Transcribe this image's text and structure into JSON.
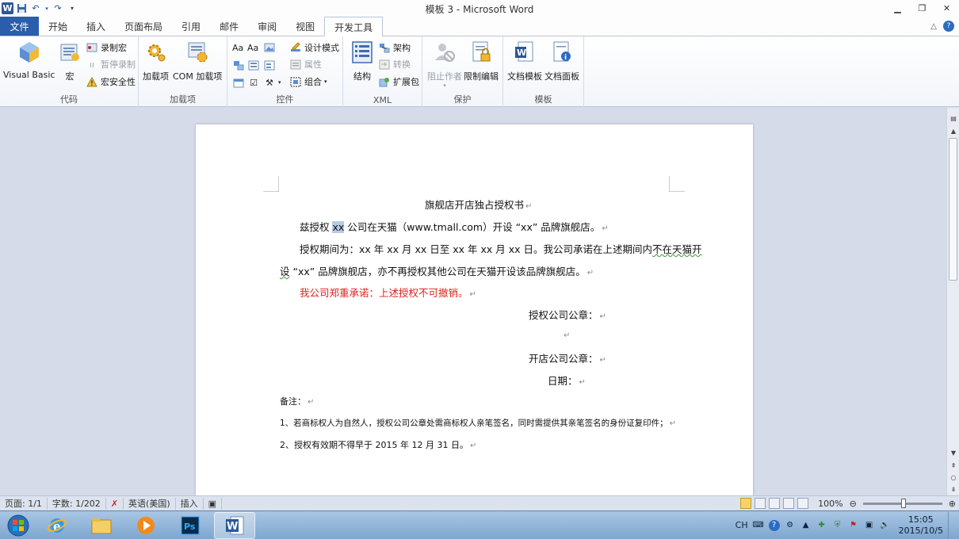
{
  "window": {
    "title": "模板 3  -  Microsoft Word",
    "app_icon_letter": "W",
    "controls": [
      "minimize-icon",
      "restore-icon",
      "close-icon"
    ]
  },
  "ribbon_tabs": [
    {
      "label": "文件"
    },
    {
      "label": "开始"
    },
    {
      "label": "插入"
    },
    {
      "label": "页面布局"
    },
    {
      "label": "引用"
    },
    {
      "label": "邮件"
    },
    {
      "label": "审阅"
    },
    {
      "label": "视图"
    },
    {
      "label": "开发工具"
    }
  ],
  "active_tab": "开发工具",
  "ribbon": {
    "code": {
      "label": "代码",
      "visual_basic": "Visual Basic",
      "macros": "宏",
      "record_macro": "录制宏",
      "pause_recording": "暂停录制",
      "macro_security": "宏安全性"
    },
    "addins": {
      "label": "加载项",
      "addins": "加载项",
      "com_addins": "COM 加载项"
    },
    "controls": {
      "label": "控件",
      "design_mode": "设计模式",
      "properties": "属性",
      "group": "组合"
    },
    "xml": {
      "label": "XML",
      "structure": "结构",
      "schema": "架构",
      "transform": "转换",
      "expansion_packs": "扩展包"
    },
    "protect": {
      "label": "保护",
      "block_authors": "阻止作者",
      "restrict_editing": "限制编辑"
    },
    "templates": {
      "label": "模板",
      "document_template": "文档模板",
      "document_panel": "文档面板"
    }
  },
  "document": {
    "title": "旗舰店开店独占授权书",
    "line1_a": "兹授权 ",
    "line1_sel": "xx",
    "line1_b": " 公司在天猫（www.tmall.com）开设 “xx” 品牌旗舰店。",
    "line2_a": "授权期间为：xx 年 xx 月 xx 日至 xx 年 xx 月 xx 日。我公司承诺在上述期间内",
    "line2_wavy": "不在天猫开",
    "line3_wavy": "设",
    "line3_a": " “xx” 品牌旗舰店，亦不再授权其他公司在天猫开设该品牌旗舰店。",
    "line4_red": "我公司郑重承诺：上述授权不可撤销。",
    "authorizer_seal": "授权公司公章：",
    "store_seal": "开店公司公章：",
    "date": "日期：",
    "notes_label": "备注：",
    "note1": "1、若商标权人为自然人，授权公司公章处需商标权人亲笔签名，同时需提供其亲笔签名的身份证复印件；",
    "note2": "2、授权有效期不得早于 2015 年 12 月 31 日。",
    "para_mark": "↵"
  },
  "status": {
    "page": "页面: 1/1",
    "words": "字数: 1/202",
    "language": "英语(美国)",
    "mode": "插入",
    "zoom": "100%"
  },
  "taskbar": {
    "apps": [
      "start-orb-icon",
      "internet-explorer-icon",
      "file-explorer-icon",
      "media-player-icon",
      "photoshop-icon",
      "word-icon"
    ],
    "active_app": "word-icon",
    "tray_lang": "CH",
    "time": "15:05",
    "date": "2015/10/5"
  },
  "colors": {
    "file_tab": "#2a5daa",
    "word_blue": "#2b5797",
    "red_text": "#e0231f",
    "selection": "#b7cbe6"
  }
}
